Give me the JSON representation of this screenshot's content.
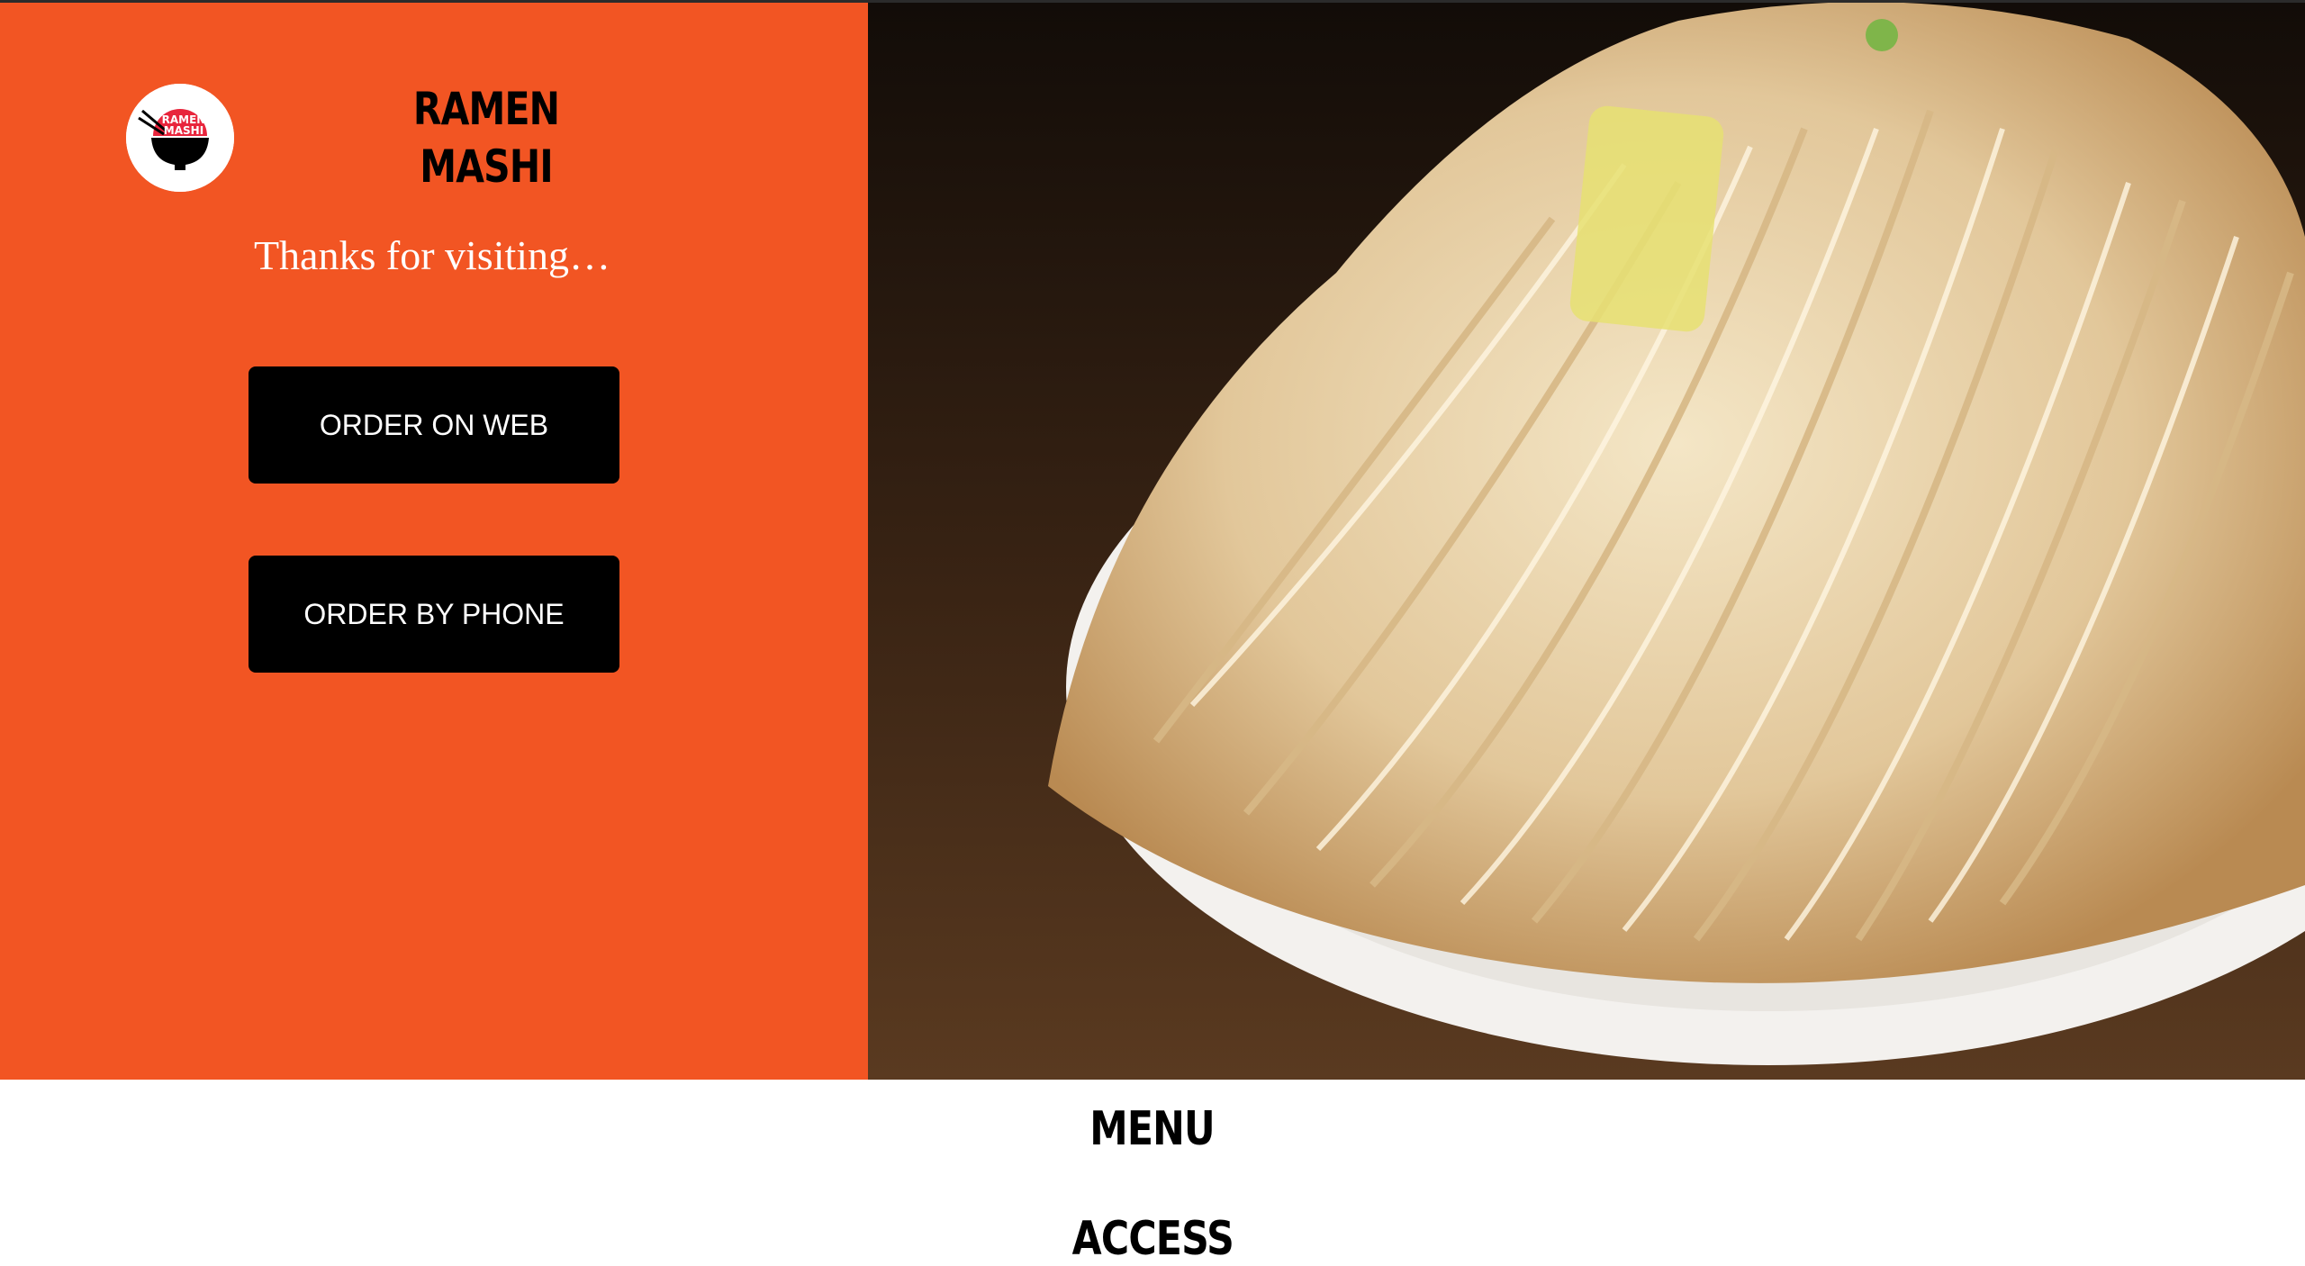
{
  "brand": {
    "name_line1": "RAMEN",
    "name_line2": "MASHI",
    "logo_text_line1": "RAMEN",
    "logo_text_line2": "MASHI",
    "accent_color": "#f25523"
  },
  "hero": {
    "tagline": "Thanks for visiting…",
    "order_web_label": "ORDER ON WEB",
    "order_phone_label": "ORDER BY PHONE"
  },
  "nav": {
    "menu_label": "MENU",
    "access_label": "ACCESS"
  },
  "icons": {
    "logo": "ramen-bowl-logo-icon"
  }
}
